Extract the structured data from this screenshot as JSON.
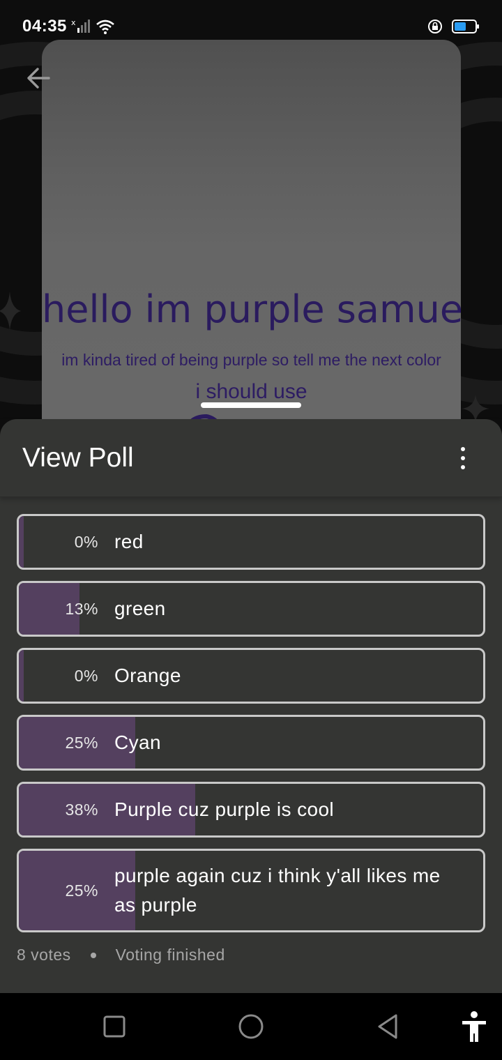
{
  "status_bar": {
    "time": "04:35",
    "icons": [
      "signal-icon",
      "wifi-icon",
      "rotation-lock-icon",
      "battery-icon"
    ]
  },
  "story": {
    "title": "hello im purple samuel",
    "subtitle_line1": "im kinda tired of being purple so tell me the next color",
    "subtitle_line2": "i should use"
  },
  "sheet": {
    "title": "View Poll"
  },
  "poll": {
    "options": [
      {
        "percent_label": "0%",
        "label": "red",
        "fraction": 0.0
      },
      {
        "percent_label": "13%",
        "label": "green",
        "fraction": 0.13
      },
      {
        "percent_label": "0%",
        "label": "Orange",
        "fraction": 0.0
      },
      {
        "percent_label": "25%",
        "label": "Cyan",
        "fraction": 0.25
      },
      {
        "percent_label": "38%",
        "label": "Purple cuz purple is cool",
        "fraction": 0.38
      },
      {
        "percent_label": "25%",
        "label": "purple again cuz i think y'all likes me as purple",
        "fraction": 0.25
      }
    ],
    "votes": "8 votes",
    "status": "Voting finished"
  },
  "colors": {
    "sheet_bg": "#343533",
    "fill": "#54405f",
    "border": "#c9c9c9",
    "story_text": "#2a1b5e"
  }
}
